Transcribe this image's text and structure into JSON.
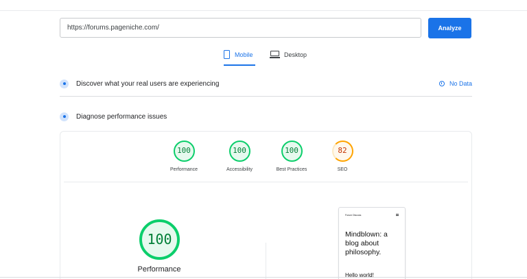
{
  "search": {
    "url_value": "https://forums.pageniche.com/",
    "analyze_label": "Analyze"
  },
  "tabs": [
    {
      "label": "Mobile",
      "icon": "mobile-phone-icon",
      "active": true
    },
    {
      "label": "Desktop",
      "icon": "desktop-monitor-icon",
      "active": false
    }
  ],
  "field_data": {
    "heading": "Discover what your real users are experiencing",
    "status": "No Data"
  },
  "lab_data": {
    "heading": "Diagnose performance issues",
    "scores": [
      {
        "value": "100",
        "label": "Performance",
        "rating": "pass"
      },
      {
        "value": "100",
        "label": "Accessibility",
        "rating": "pass"
      },
      {
        "value": "100",
        "label": "Best Practices",
        "rating": "pass"
      },
      {
        "value": "82",
        "label": "SEO",
        "rating": "average"
      }
    ],
    "main_score": {
      "value": "100",
      "label": "Performance"
    }
  },
  "preview": {
    "site_name": "Forum Discuss",
    "headline": "Mindblown: a blog about philosophy.",
    "post_title": "Hello world!"
  },
  "colors": {
    "accent": "#1a73e8",
    "pass": "#0cce6b",
    "average": "#ffa400"
  }
}
